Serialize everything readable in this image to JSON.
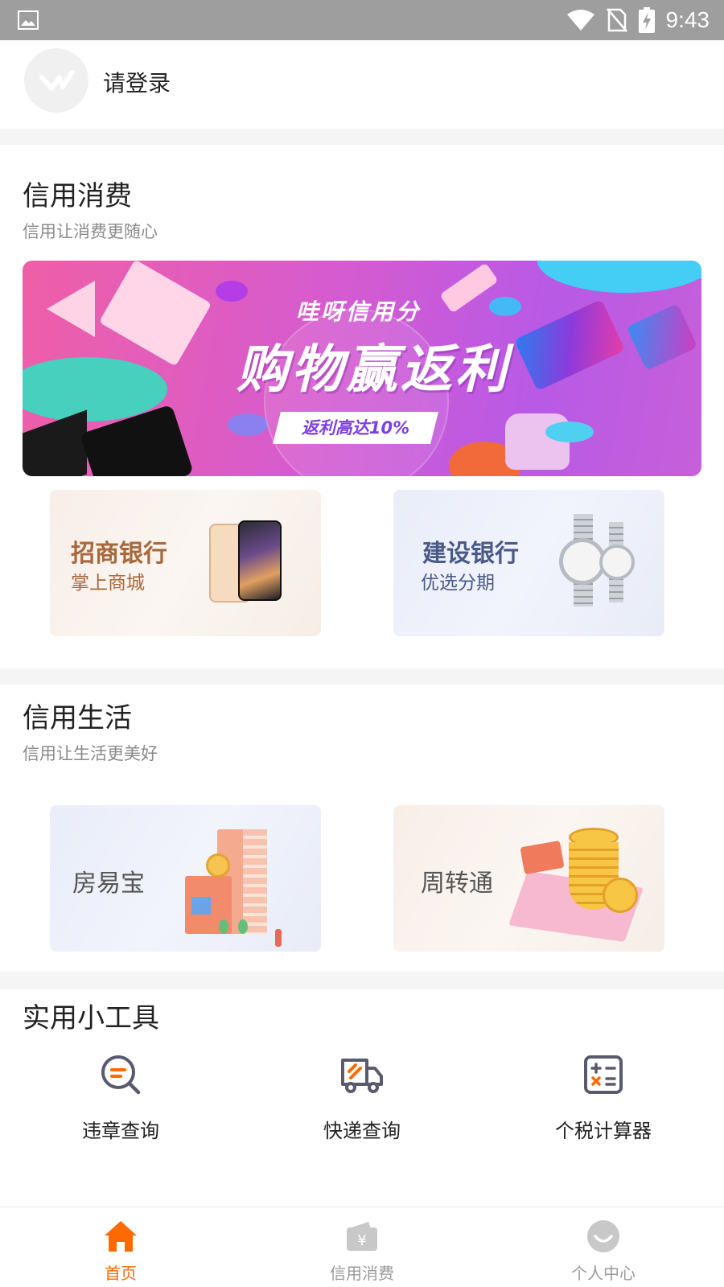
{
  "status_bar": {
    "time": "9:43"
  },
  "login": {
    "label": "请登录"
  },
  "credit_consumption": {
    "title": "信用消费",
    "subtitle": "信用让消费更随心",
    "banner": {
      "subtitle": "哇呀信用分",
      "title": "购物赢返利",
      "tag": "返利高达10%"
    },
    "cards": [
      {
        "title": "招商银行",
        "subtitle": "掌上商城"
      },
      {
        "title": "建设银行",
        "subtitle": "优选分期"
      }
    ]
  },
  "credit_life": {
    "title": "信用生活",
    "subtitle": "信用让生活更美好",
    "cards": [
      {
        "title": "房易宝"
      },
      {
        "title": "周转通"
      }
    ]
  },
  "tools": {
    "title": "实用小工具",
    "items": [
      {
        "label": "违章查询",
        "icon": "search-magnifier-icon"
      },
      {
        "label": "快递查询",
        "icon": "delivery-truck-icon"
      },
      {
        "label": "个税计算器",
        "icon": "calculator-icon"
      }
    ]
  },
  "tab_bar": {
    "items": [
      {
        "label": "首页",
        "icon": "home-icon",
        "active": true
      },
      {
        "label": "信用消费",
        "icon": "wallet-yen-icon",
        "active": false
      },
      {
        "label": "个人中心",
        "icon": "person-smile-icon",
        "active": false
      }
    ]
  },
  "colors": {
    "accent": "#ff6a00",
    "inactive_tab": "#9a9a9a",
    "card_warm_text": "#a8683c",
    "card_cool_text": "#4a5a86"
  }
}
